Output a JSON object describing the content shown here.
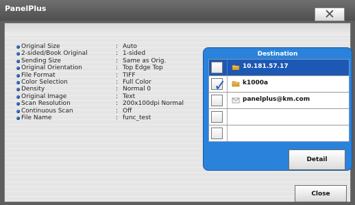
{
  "window": {
    "title": "PanelPlus"
  },
  "info": [
    {
      "label": "Original Size",
      "value": "Auto"
    },
    {
      "label": "2-sided/Book Original",
      "value": "1-sided"
    },
    {
      "label": "Sending Size",
      "value": "Same as Orig."
    },
    {
      "label": "Original Orientation",
      "value": "Top Edge Top"
    },
    {
      "label": "File Format",
      "value": "TIFF"
    },
    {
      "label": "Color Selection",
      "value": "Full Color"
    },
    {
      "label": "Density",
      "value": "Normal 0"
    },
    {
      "label": "Original Image",
      "value": "Text"
    },
    {
      "label": "Scan Resolution",
      "value": "200x100dpi Normal"
    },
    {
      "label": "Continuous Scan",
      "value": "Off"
    },
    {
      "label": "File Name",
      "value": "func_test"
    }
  ],
  "info_separator": ":",
  "destination": {
    "title": "Destination",
    "rows": [
      {
        "text": "10.181.57.17",
        "checked": false,
        "selected": true,
        "icon": "folder-icon"
      },
      {
        "text": "k1000a",
        "checked": true,
        "selected": false,
        "icon": "folder-icon"
      },
      {
        "text": "panelplus@km.com",
        "checked": false,
        "selected": false,
        "icon": "mail-icon"
      },
      {
        "text": "",
        "checked": false,
        "selected": false,
        "icon": ""
      },
      {
        "text": "",
        "checked": false,
        "selected": false,
        "icon": ""
      }
    ],
    "detail_label": "Detail"
  },
  "buttons": {
    "close_label": "Close",
    "close_x": "✕"
  },
  "colors": {
    "accent": "#2a82da",
    "selected_row": "#1d58b4"
  }
}
